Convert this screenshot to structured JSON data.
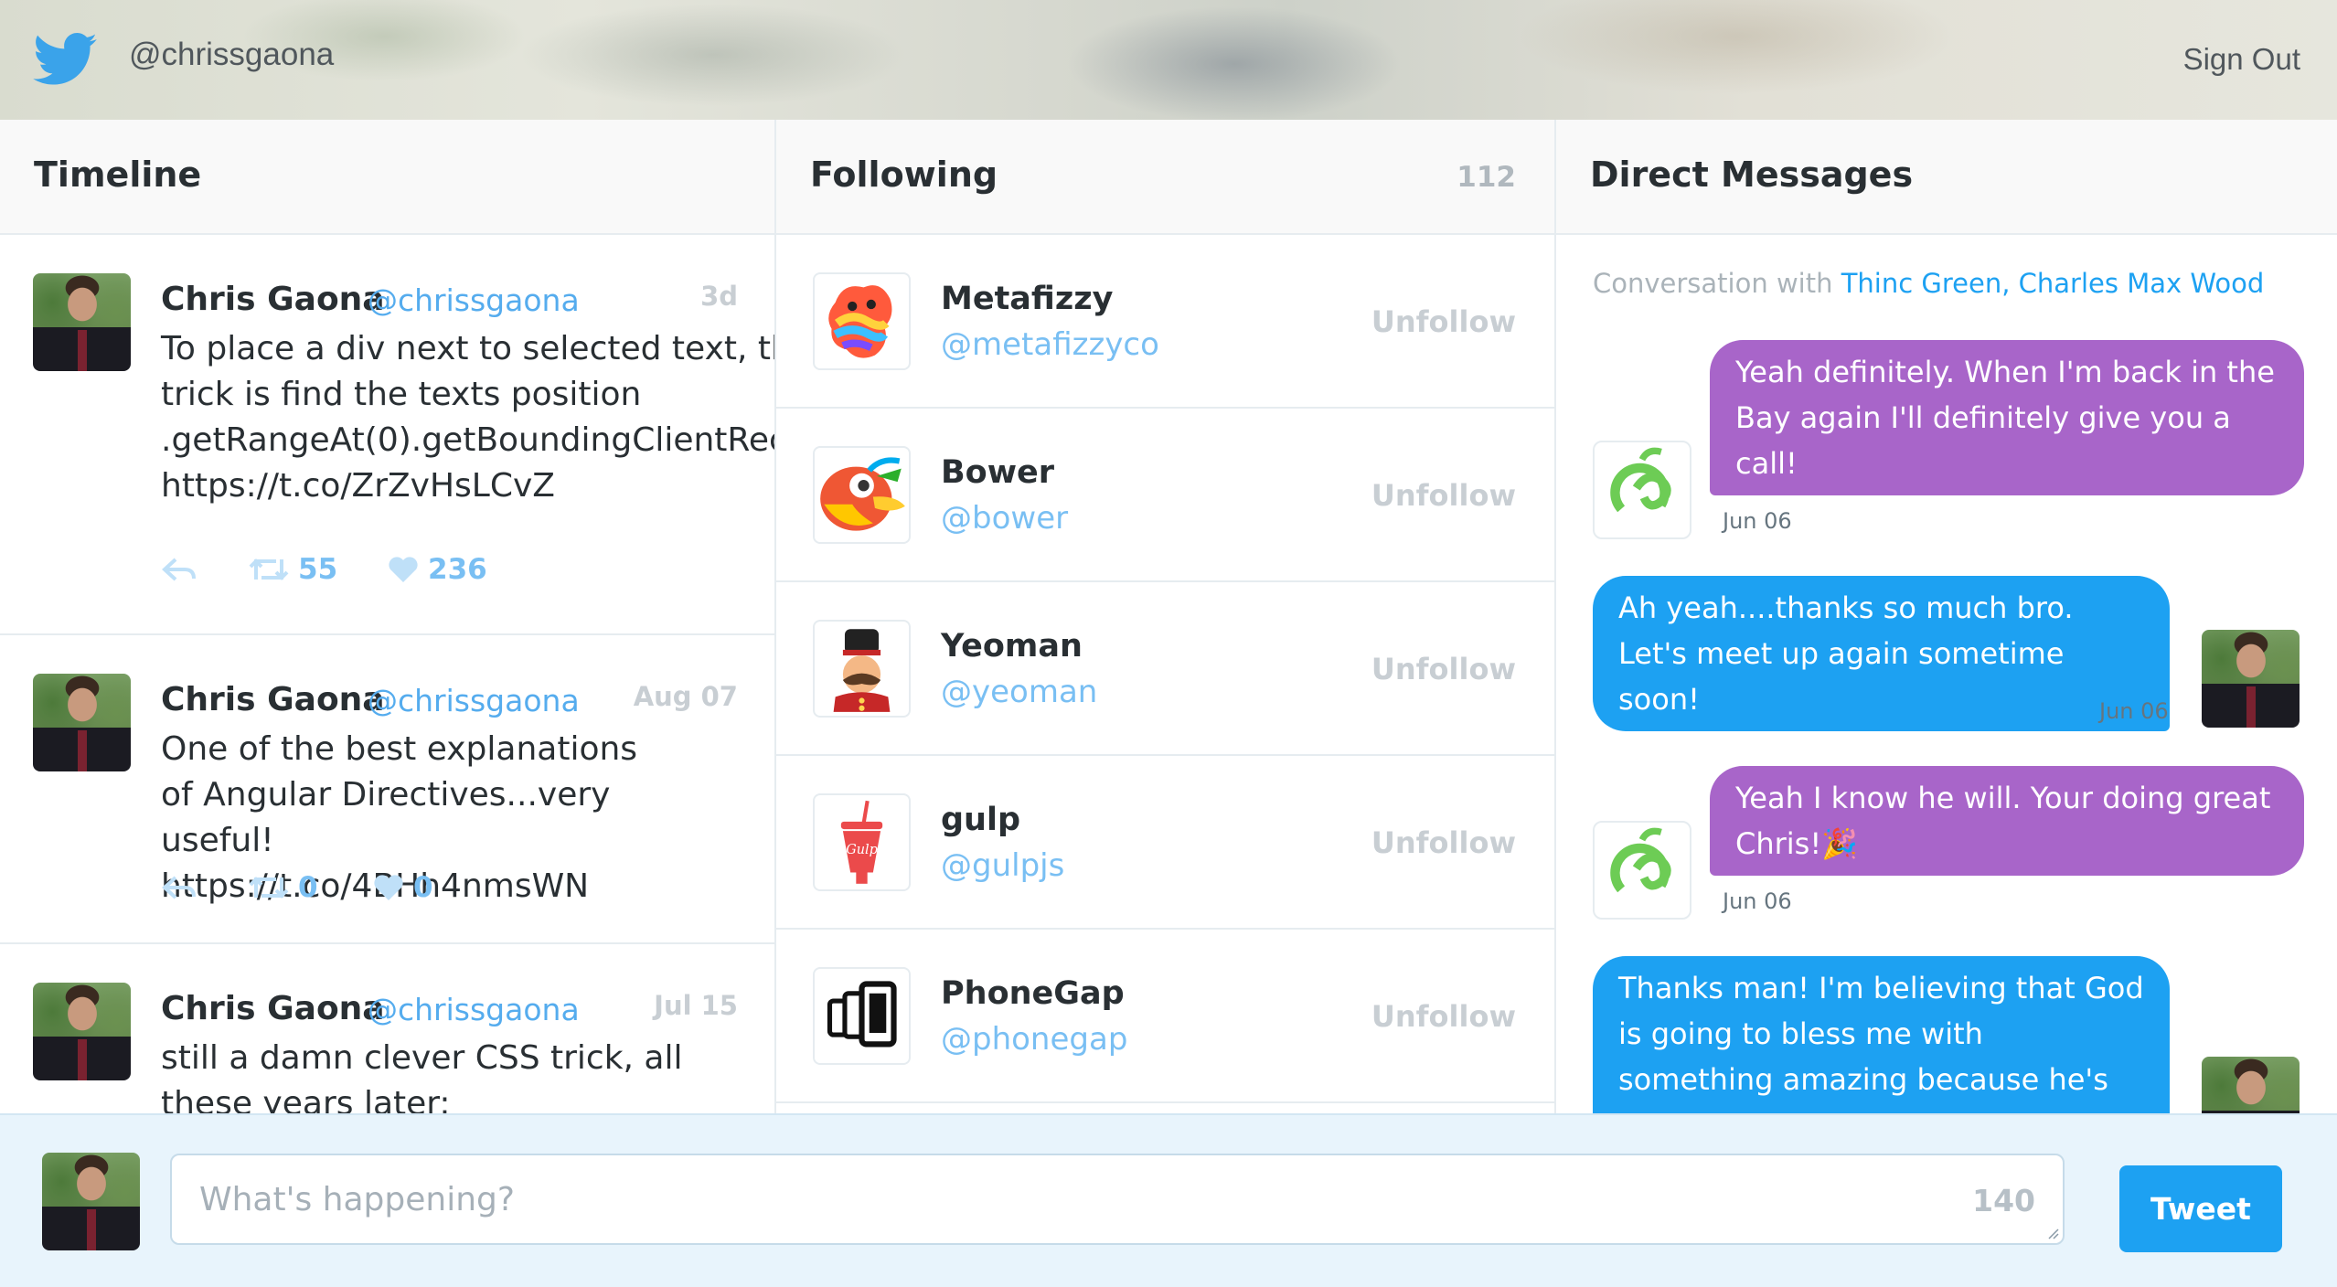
{
  "header": {
    "brand_icon": "twitter-bird-icon",
    "handle": "@chrissgaona",
    "signout_label": "Sign Out"
  },
  "colors": {
    "accent": "#1da1f2",
    "link": "#55acee",
    "sent_bubble": "#1da1f2",
    "received_bubble": "#a865c9",
    "composer_bg": "#e8f4fc"
  },
  "timeline": {
    "title": "Timeline",
    "tweets": [
      {
        "name": "Chris Gaona",
        "handle": "@chrissgaona",
        "date": "3d",
        "text": "To place a div next to selected text, the trick is find the texts position .getRangeAt(0).getBoundingClientRect() https://t.co/ZrZvHsLCvZ",
        "retweets": "55",
        "likes": "236"
      },
      {
        "name": "Chris Gaona",
        "handle": "@chrissgaona",
        "date": "Aug 07",
        "text": "One of the best explanations of Angular Directives...very useful! https://t.co/4BHh4nmsWN",
        "retweets": "0",
        "likes": "0"
      },
      {
        "name": "Chris Gaona",
        "handle": "@chrissgaona",
        "date": "Jul 15",
        "text": "still a damn clever CSS trick, all these years later:"
      }
    ]
  },
  "following": {
    "title": "Following",
    "count": "112",
    "unfollow_label": "Unfollow",
    "items": [
      {
        "name": "Metafizzy",
        "handle": "@metafizzyco",
        "icon": "metafizzy-logo-icon"
      },
      {
        "name": "Bower",
        "handle": "@bower",
        "icon": "bower-logo-icon"
      },
      {
        "name": "Yeoman",
        "handle": "@yeoman",
        "icon": "yeoman-logo-icon"
      },
      {
        "name": "gulp",
        "handle": "@gulpjs",
        "icon": "gulp-logo-icon"
      },
      {
        "name": "PhoneGap",
        "handle": "@phonegap",
        "icon": "phonegap-logo-icon"
      }
    ]
  },
  "dm": {
    "title": "Direct Messages",
    "conversation_prefix": "Conversation with",
    "conversation_names": "Thinc Green, Charles Max Wood",
    "messages": [
      {
        "text": "Yeah definitely. When I'm back in the Bay again I'll definitely give you a call!",
        "time": "Jun 06",
        "direction": "received"
      },
      {
        "text": "Ah yeah....thanks so much bro. Let's meet up again sometime soon!",
        "time": "Jun 06",
        "direction": "sent"
      },
      {
        "text": "Yeah I know he will. Your doing great Chris!🎉",
        "time": "Jun 06",
        "direction": "received"
      },
      {
        "text": "Thanks man! I'm believing that God is going to bless me with something amazing because he's GOOD!!",
        "direction": "sent"
      }
    ]
  },
  "composer": {
    "placeholder": "What's happening?",
    "count": "140",
    "button_label": "Tweet"
  }
}
